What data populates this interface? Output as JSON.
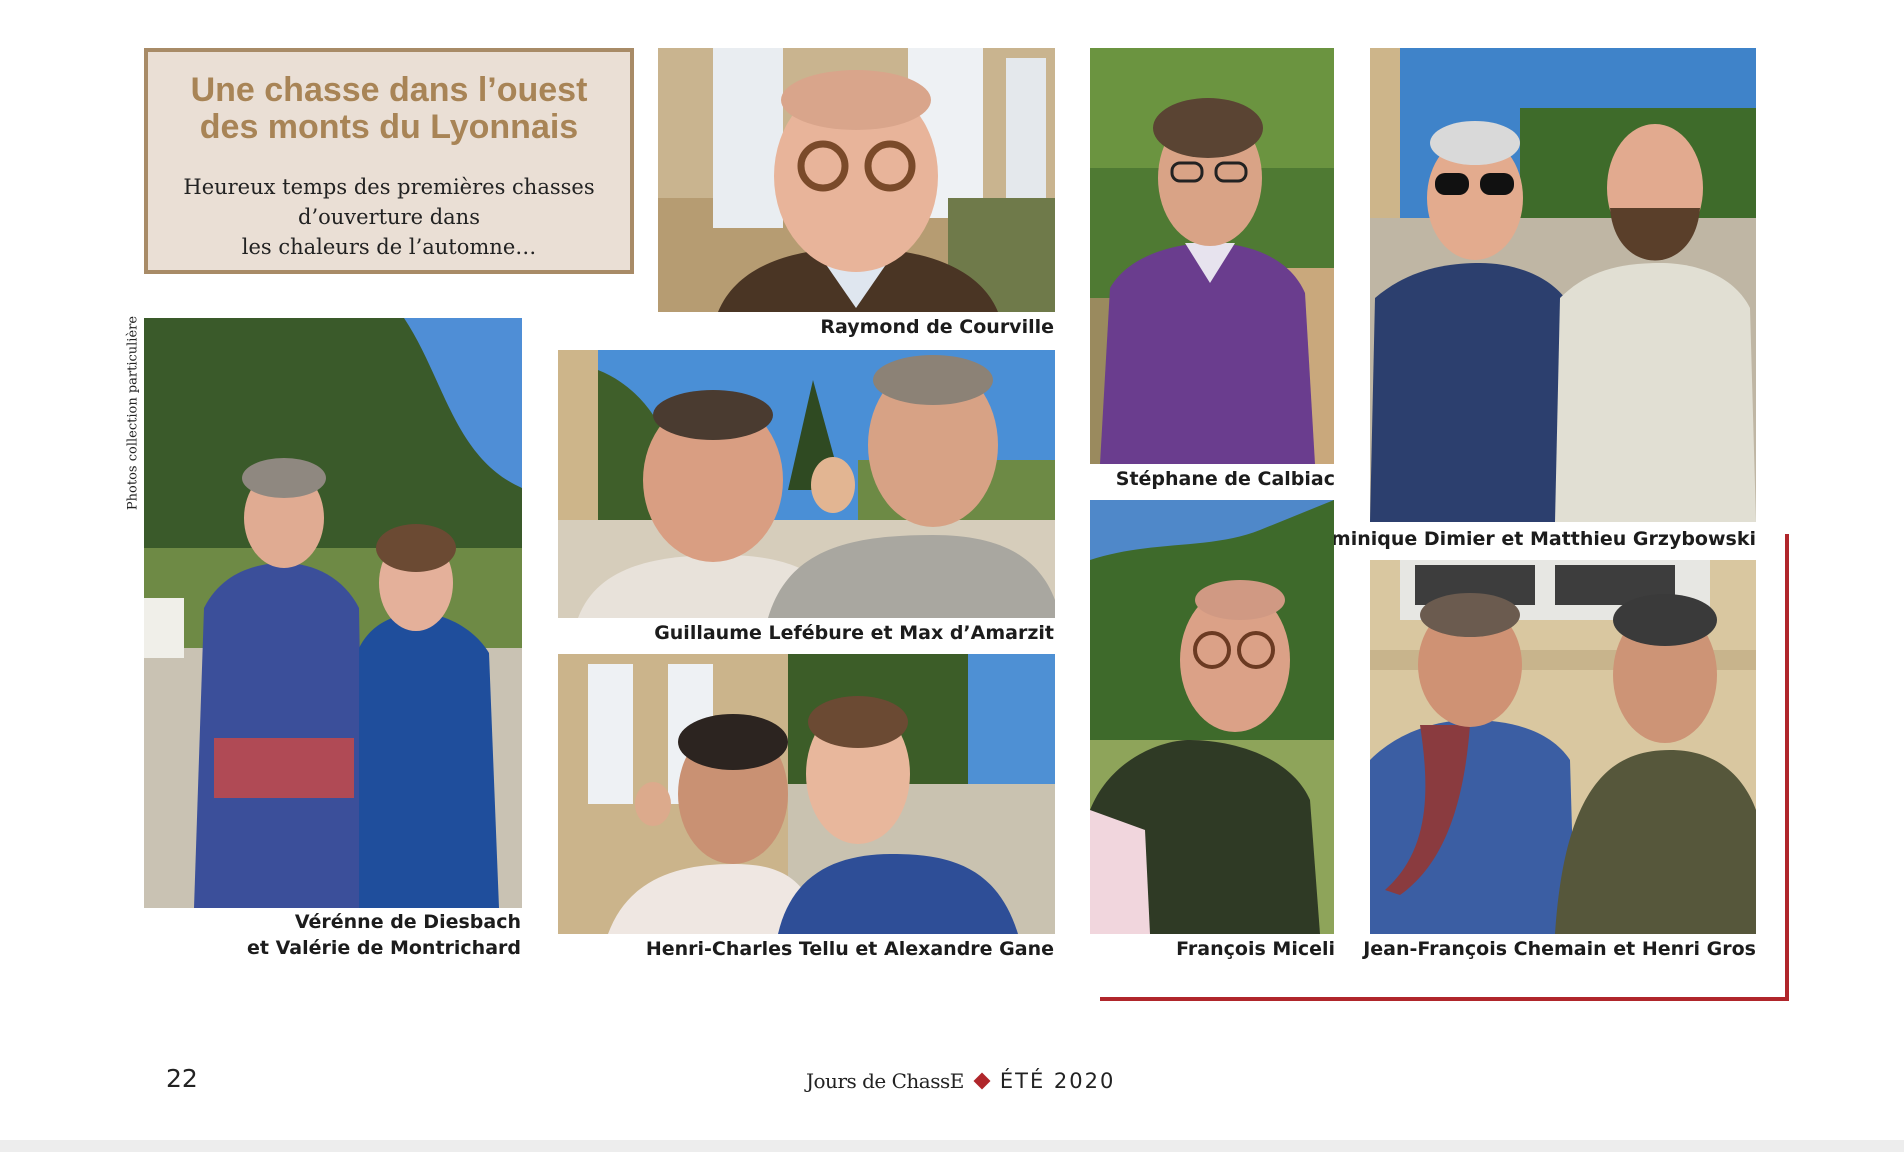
{
  "article": {
    "title_lines": [
      "Une chasse dans l’ouest",
      "des monts du Lyonnais"
    ],
    "subtitle_lines": [
      "Heureux temps des premières chasses",
      "d’ouverture dans",
      "les chaleurs de l’automne…"
    ],
    "photo_credit": "Photos collection particulière"
  },
  "photos": [
    {
      "id": "raymond",
      "caption_lines": [
        "Raymond de Courville"
      ]
    },
    {
      "id": "stephane",
      "caption_lines": [
        "Stéphane de Calbiac"
      ]
    },
    {
      "id": "dominique",
      "caption_lines": [
        "Dominique Dimier et Matthieu Grzybowski"
      ]
    },
    {
      "id": "verenne",
      "caption_lines": [
        "Vérénne de Diesbach",
        "et Valérie de Montrichard"
      ]
    },
    {
      "id": "guillaume",
      "caption_lines": [
        "Guillaume Lefébure et Max d’Amarzit"
      ]
    },
    {
      "id": "henri-charles",
      "caption_lines": [
        "Henri-Charles Tellu et Alexandre Gane"
      ]
    },
    {
      "id": "francois",
      "caption_lines": [
        "François Miceli"
      ]
    },
    {
      "id": "jean-francois",
      "caption_lines": [
        "Jean-François Chemain et Henri Gros"
      ]
    }
  ],
  "footer": {
    "page_number": "22",
    "magazine": "Jours de ChassE",
    "issue": "ÉTÉ 2020"
  },
  "colors": {
    "title_gold": "#a88456",
    "title_box_bg": "#eadfd5",
    "title_box_border": "#a88b67",
    "accent_red": "#b0262b"
  }
}
